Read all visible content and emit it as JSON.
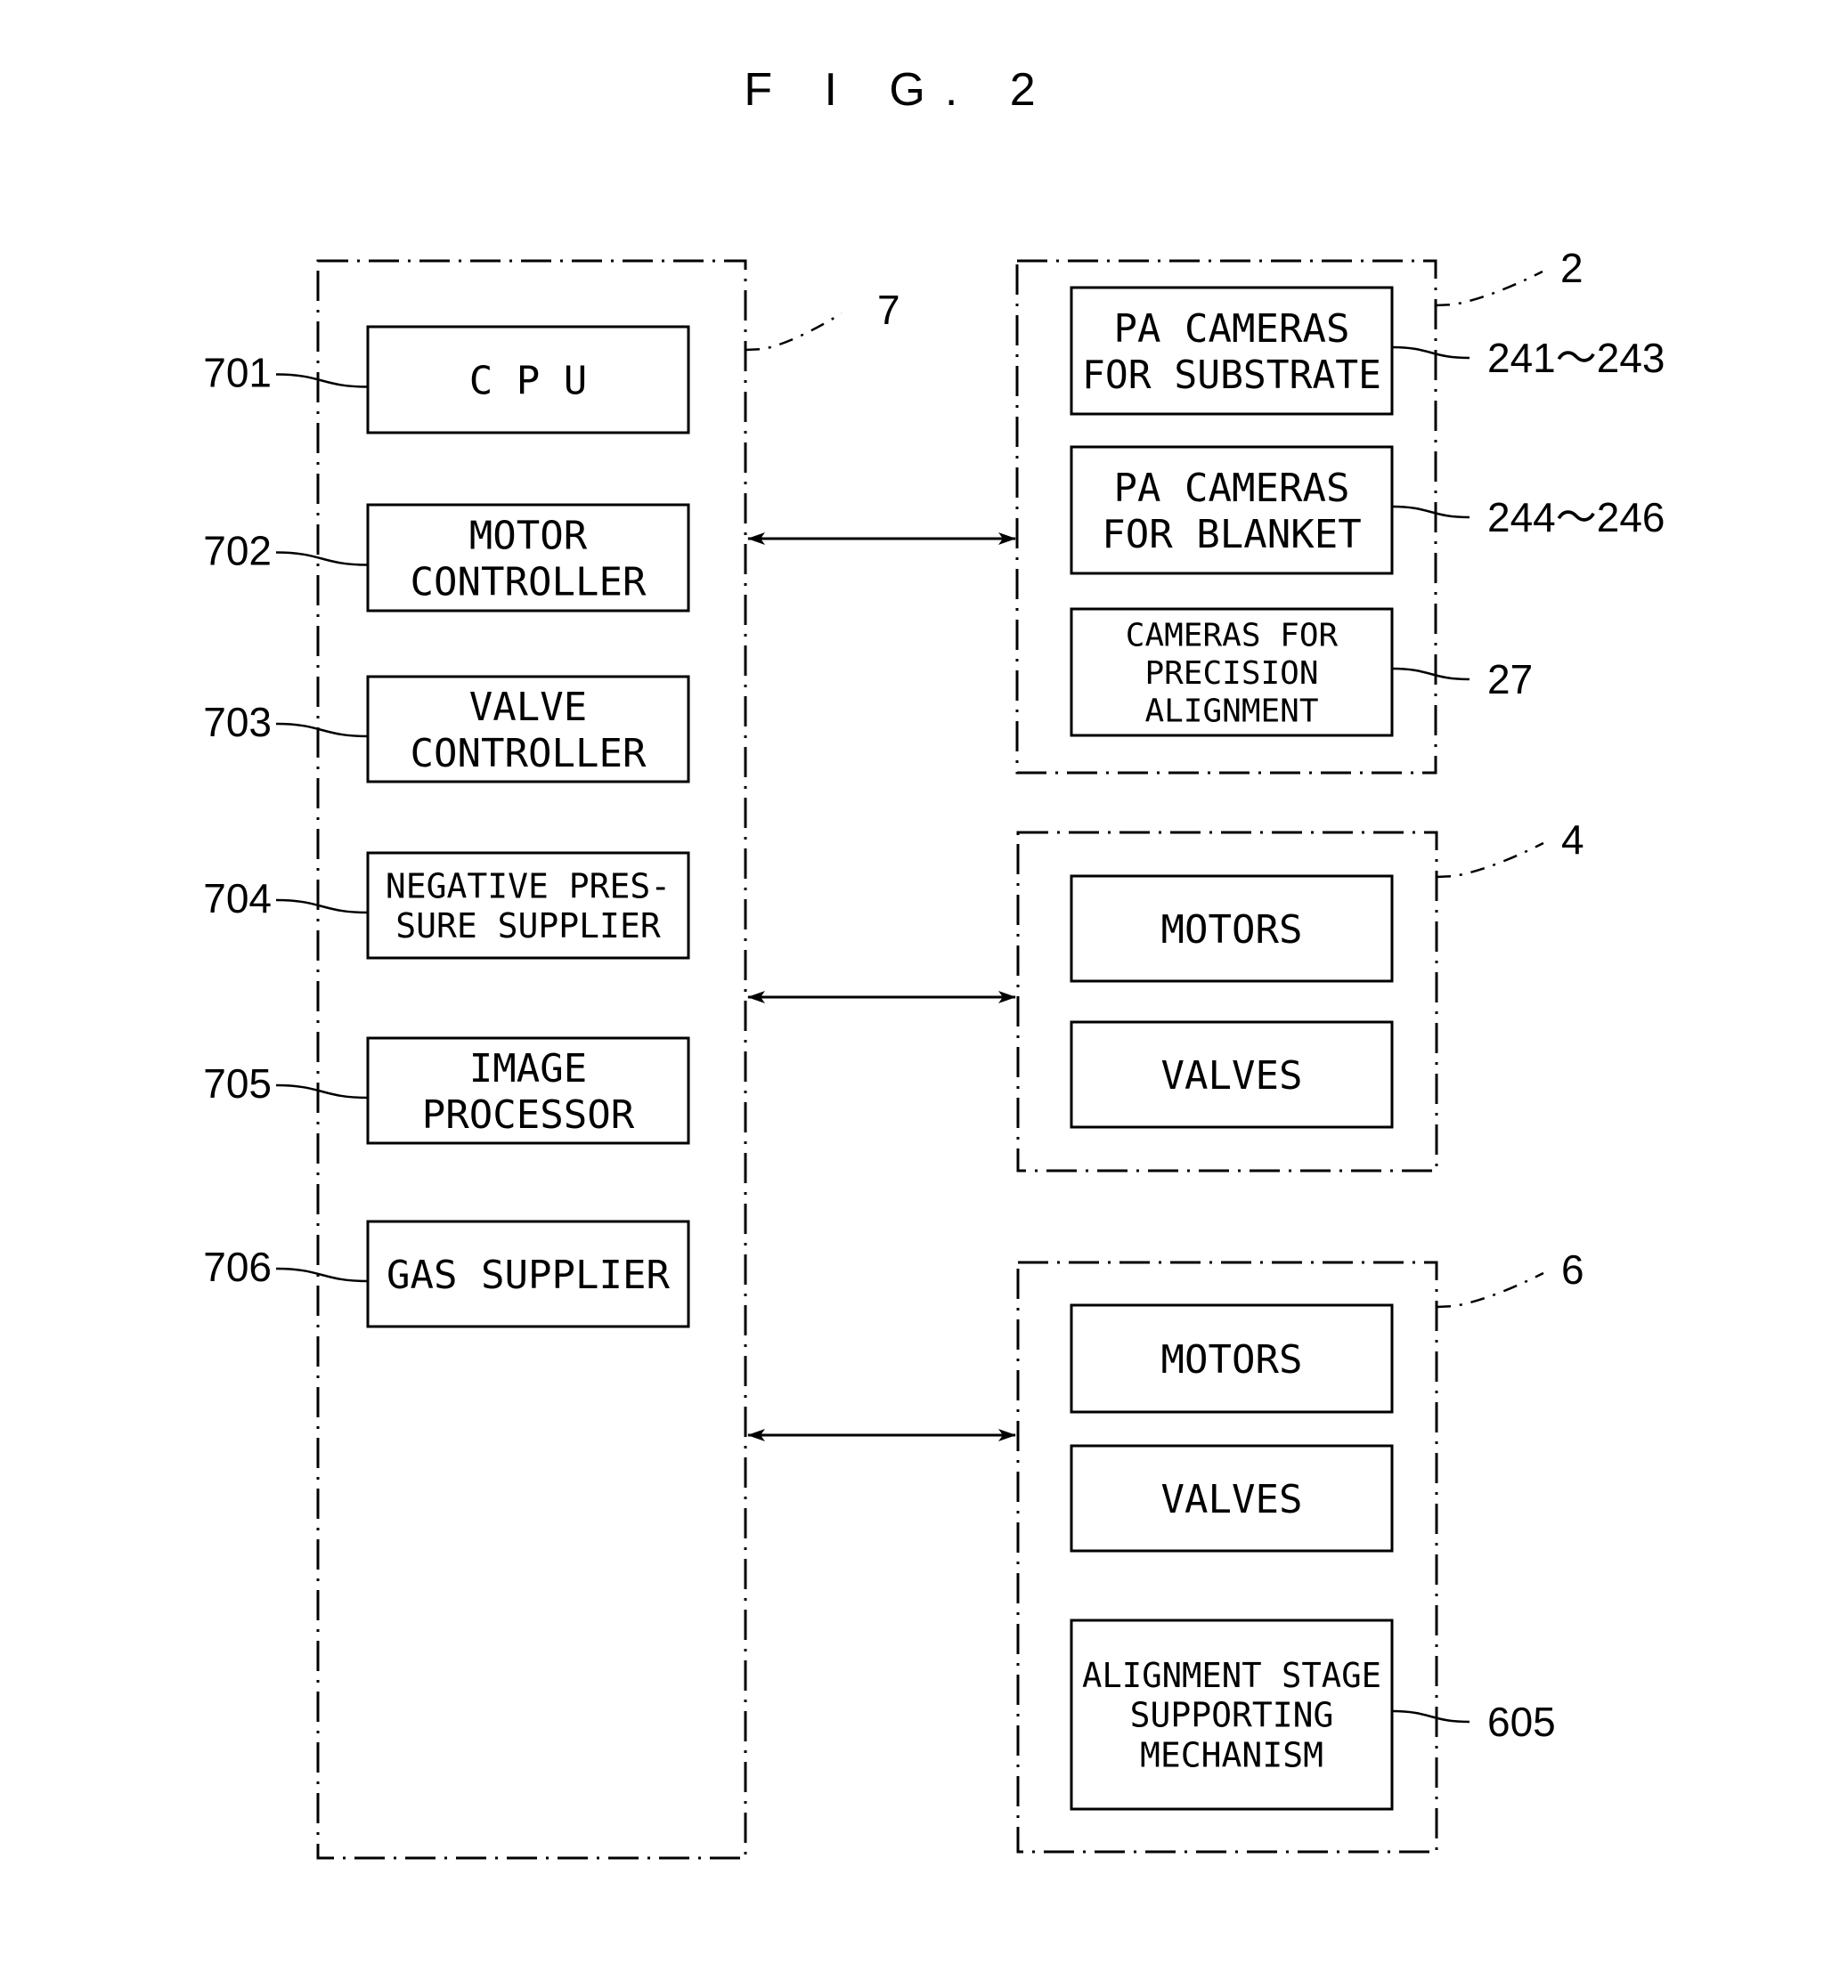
{
  "figure": {
    "title": "F I G. 2"
  },
  "controller": {
    "ref": "7",
    "items": [
      {
        "ref": "701",
        "lines": [
          "C P U"
        ]
      },
      {
        "ref": "702",
        "lines": [
          "MOTOR",
          "CONTROLLER"
        ]
      },
      {
        "ref": "703",
        "lines": [
          "VALVE",
          "CONTROLLER"
        ]
      },
      {
        "ref": "704",
        "lines": [
          "NEGATIVE PRES-",
          "SURE SUPPLIER"
        ]
      },
      {
        "ref": "705",
        "lines": [
          "IMAGE",
          "PROCESSOR"
        ]
      },
      {
        "ref": "706",
        "lines": [
          "GAS SUPPLIER"
        ]
      }
    ]
  },
  "groups": [
    {
      "ref": "2",
      "items": [
        {
          "ref": "241～243",
          "lines": [
            "PA CAMERAS",
            "FOR SUBSTRATE"
          ]
        },
        {
          "ref": "244～246",
          "lines": [
            "PA CAMERAS",
            "FOR BLANKET"
          ]
        },
        {
          "ref": "27",
          "lines": [
            "CAMERAS FOR",
            "PRECISION",
            "ALIGNMENT"
          ]
        }
      ]
    },
    {
      "ref": "4",
      "items": [
        {
          "ref": "",
          "lines": [
            "MOTORS"
          ]
        },
        {
          "ref": "",
          "lines": [
            "VALVES"
          ]
        }
      ]
    },
    {
      "ref": "6",
      "items": [
        {
          "ref": "",
          "lines": [
            "MOTORS"
          ]
        },
        {
          "ref": "",
          "lines": [
            "VALVES"
          ]
        },
        {
          "ref": "605",
          "lines": [
            "ALIGNMENT STAGE",
            "SUPPORTING",
            "MECHANISM"
          ]
        }
      ]
    }
  ],
  "connections": [
    {
      "from": "7",
      "to": "2",
      "direction": "bidirectional"
    },
    {
      "from": "7",
      "to": "4",
      "direction": "bidirectional"
    },
    {
      "from": "7",
      "to": "6",
      "direction": "bidirectional"
    }
  ]
}
